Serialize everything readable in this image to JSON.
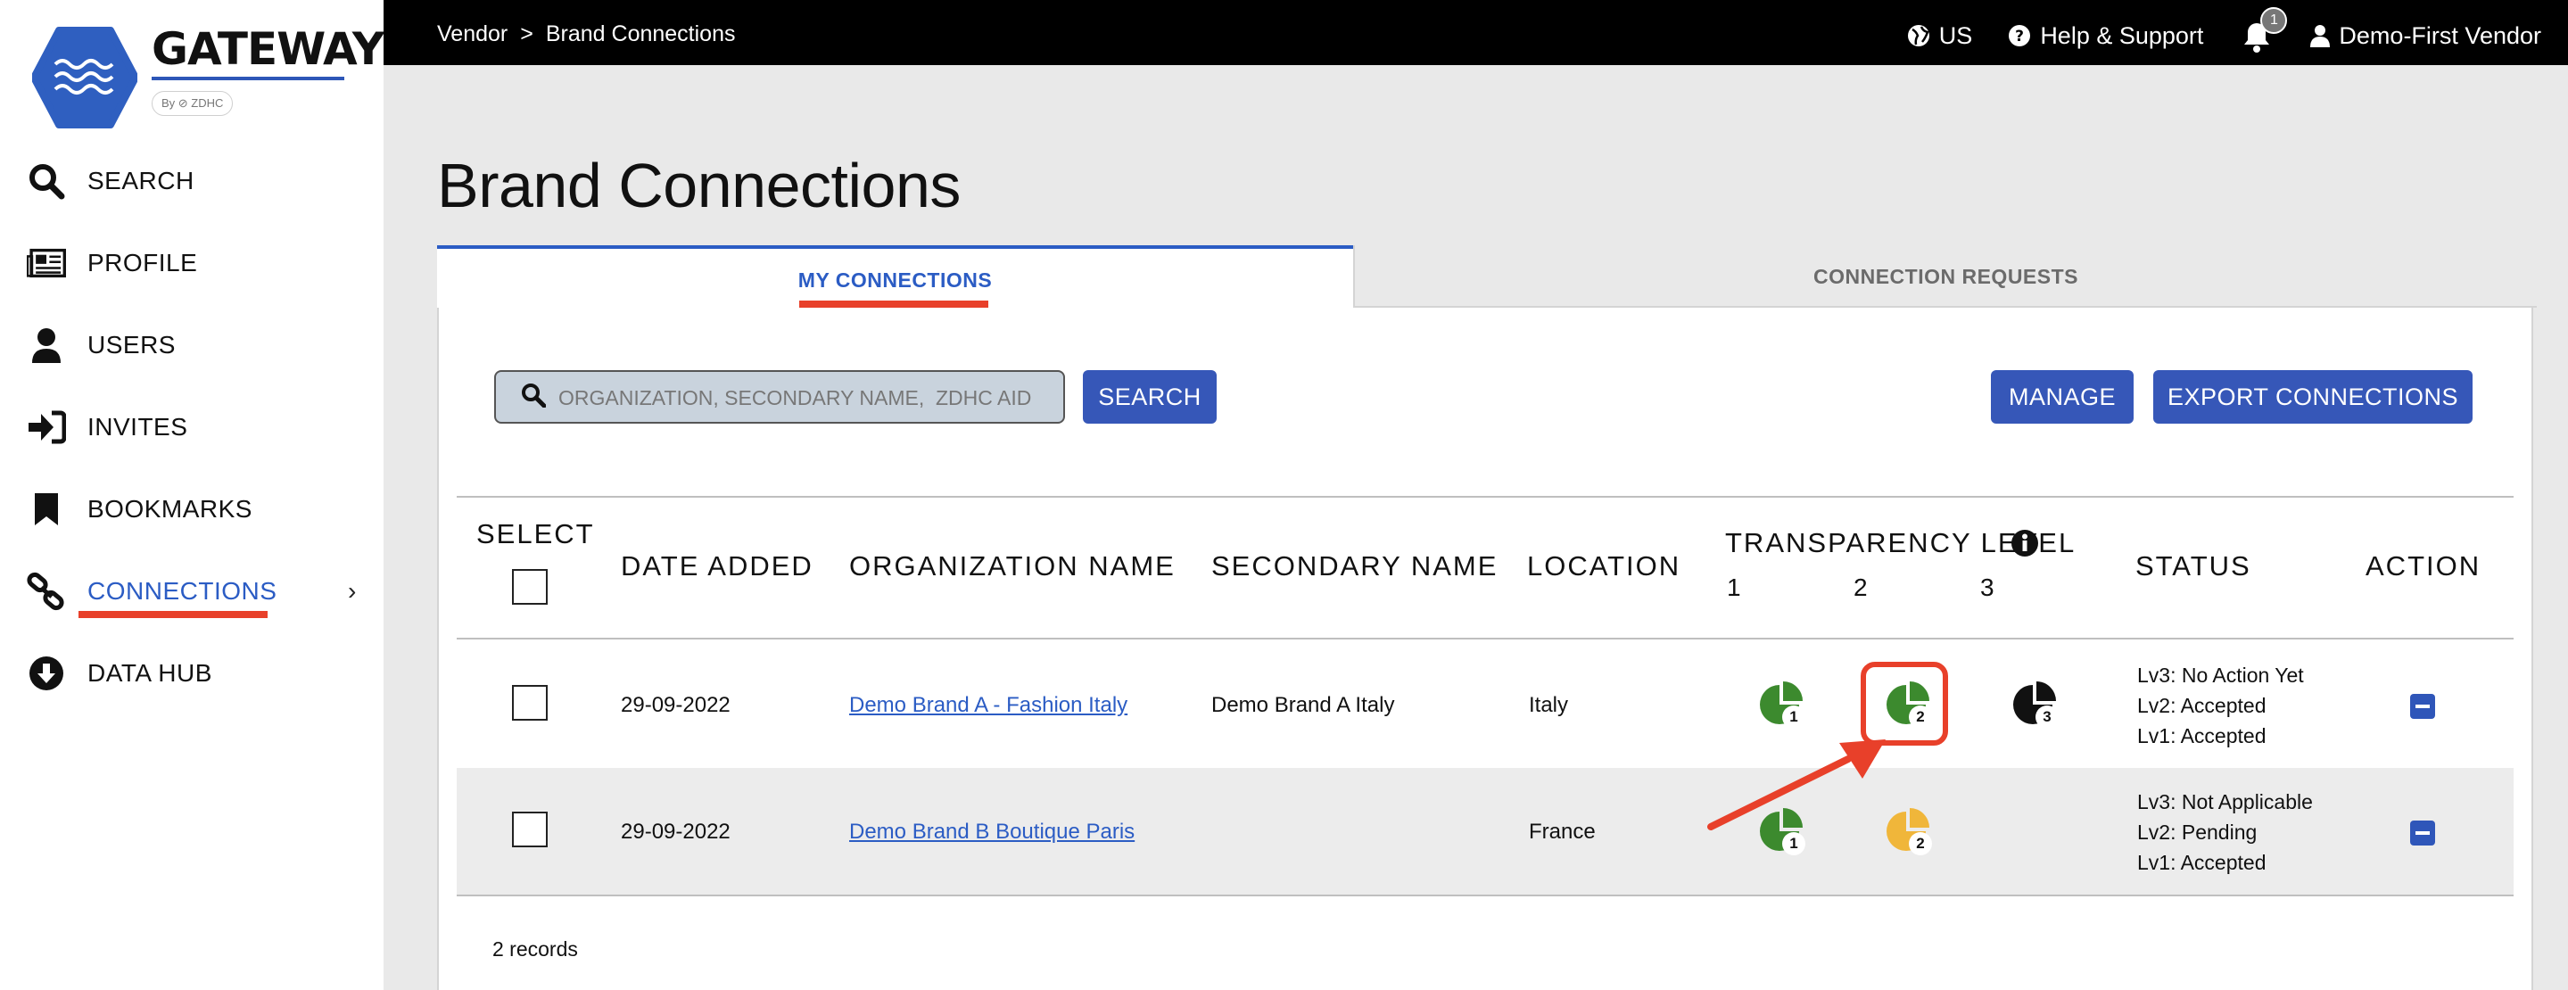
{
  "app": {
    "logo_text": "GATEWAY",
    "logo_sub": "By ⊘ ZDHC"
  },
  "sidebar": {
    "items": [
      {
        "label": "SEARCH",
        "icon": "search-icon"
      },
      {
        "label": "PROFILE",
        "icon": "newspaper-icon"
      },
      {
        "label": "USERS",
        "icon": "user-icon"
      },
      {
        "label": "INVITES",
        "icon": "sign-in-icon"
      },
      {
        "label": "BOOKMARKS",
        "icon": "bookmark-icon"
      },
      {
        "label": "CONNECTIONS",
        "icon": "link-icon",
        "active": true
      },
      {
        "label": "DATA HUB",
        "icon": "download-circle-icon"
      }
    ],
    "chevron": "›"
  },
  "topbar": {
    "breadcrumb": [
      "Vendor",
      ">",
      "Brand Connections"
    ],
    "language": "US",
    "help": "Help & Support",
    "notification_count": "1",
    "user": "Demo-First Vendor"
  },
  "page": {
    "title": "Brand Connections",
    "tabs": [
      "MY CONNECTIONS",
      "CONNECTION REQUESTS"
    ],
    "search_placeholder": "ORGANIZATION, SECONDARY NAME,  ZDHC AID",
    "search_button": "SEARCH",
    "manage_button": "MANAGE",
    "export_button": "EXPORT CONNECTIONS"
  },
  "table": {
    "headers": {
      "select": "SELECT",
      "date": "DATE ADDED",
      "org": "ORGANIZATION NAME",
      "secondary": "SECONDARY NAME",
      "location": "LOCATION",
      "transparency": "TRANSPARENCY LEVEL",
      "levels": [
        "1",
        "2",
        "3"
      ],
      "status": "STATUS",
      "action": "ACTION"
    },
    "rows": [
      {
        "date": "29-09-2022",
        "org": "Demo Brand A - Fashion Italy",
        "secondary": "Demo Brand A Italy",
        "location": "Italy",
        "levels": [
          {
            "num": "1",
            "color": "#3c8a2e"
          },
          {
            "num": "2",
            "color": "#3c8a2e"
          },
          {
            "num": "3",
            "color": "#111111"
          }
        ],
        "status": [
          "Lv3: No Action Yet",
          "Lv2: Accepted",
          "Lv1: Accepted"
        ]
      },
      {
        "date": "29-09-2022",
        "org": "Demo Brand B Boutique Paris",
        "secondary": "",
        "location": "France",
        "levels": [
          {
            "num": "1",
            "color": "#3c8a2e"
          },
          {
            "num": "2",
            "color": "#f0b63a"
          }
        ],
        "status": [
          "Lv3: Not Applicable",
          "Lv2: Pending",
          "Lv1: Accepted"
        ]
      }
    ],
    "records": "2 records"
  },
  "colors": {
    "accent": "#2b5cc4",
    "button": "#3657b8",
    "underline": "#e8402a",
    "green": "#3c8a2e",
    "amber": "#f0b63a"
  }
}
